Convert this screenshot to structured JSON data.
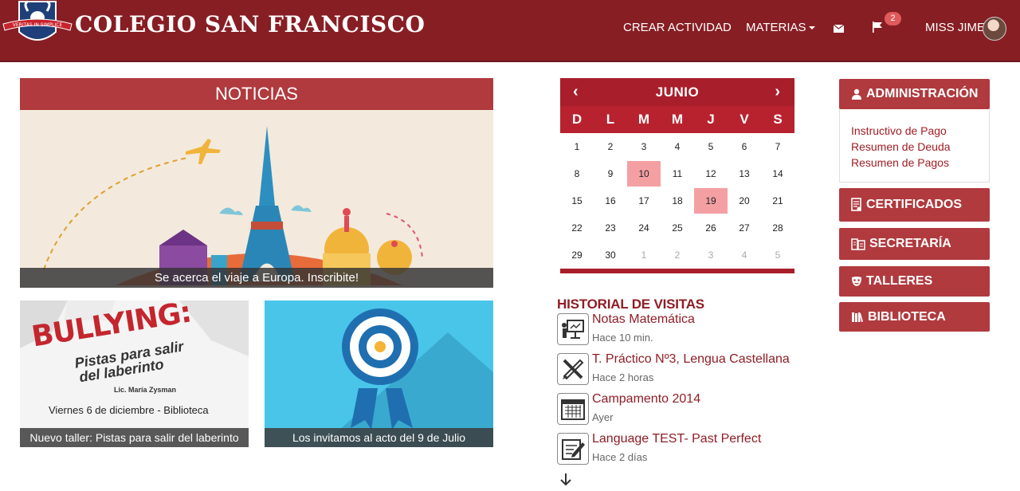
{
  "brand": {
    "title": "COLEGIO SAN FRANCISCO",
    "motto": "VERITAS IN SIMPLICE"
  },
  "nav": {
    "crear": "CREAR ACTIVIDAD",
    "materias": "MATERIAS",
    "notifications": "2",
    "user": "MISS JIME"
  },
  "news": {
    "header": "NOTICIAS",
    "hero_caption": "Se acerca el viaje a Europa. Inscribite!",
    "tile1_title_big": "BULLYING:",
    "tile1_title_1": "Pistas para salir",
    "tile1_title_2": "del laberinto",
    "tile1_author": "Lic. María Zysman",
    "tile1_date": "Viernes 6 de diciembre - Biblioteca",
    "tile1_caption": "Nuevo taller: Pistas para salir del laberinto",
    "tile2_caption": "Los invitamos al acto del 9 de Julio"
  },
  "calendar": {
    "prev": "‹",
    "next": "›",
    "month": "JUNIO",
    "weekdays": [
      "D",
      "L",
      "M",
      "M",
      "J",
      "V",
      "S"
    ],
    "days": [
      {
        "n": "1"
      },
      {
        "n": "2"
      },
      {
        "n": "3"
      },
      {
        "n": "4"
      },
      {
        "n": "5"
      },
      {
        "n": "6"
      },
      {
        "n": "7"
      },
      {
        "n": "8"
      },
      {
        "n": "9"
      },
      {
        "n": "10",
        "hl": true
      },
      {
        "n": "11"
      },
      {
        "n": "12"
      },
      {
        "n": "13"
      },
      {
        "n": "14"
      },
      {
        "n": "15"
      },
      {
        "n": "16"
      },
      {
        "n": "17"
      },
      {
        "n": "18"
      },
      {
        "n": "19",
        "hl": true
      },
      {
        "n": "20"
      },
      {
        "n": "21"
      },
      {
        "n": "22"
      },
      {
        "n": "23"
      },
      {
        "n": "24"
      },
      {
        "n": "25"
      },
      {
        "n": "26"
      },
      {
        "n": "27"
      },
      {
        "n": "28"
      },
      {
        "n": "29"
      },
      {
        "n": "30"
      },
      {
        "n": "1",
        "muted": true
      },
      {
        "n": "2",
        "muted": true
      },
      {
        "n": "3",
        "muted": true
      },
      {
        "n": "4",
        "muted": true
      },
      {
        "n": "5",
        "muted": true
      }
    ]
  },
  "history": {
    "title": "HISTORIAL DE VISITAS",
    "items": [
      {
        "name": "Notas Matemática",
        "time": "Hace 10 min.",
        "icon": "presentation-icon"
      },
      {
        "name": "T. Práctico Nº3, Lengua Castellana",
        "time": "Hace 2 horas",
        "icon": "pencil-ruler-icon"
      },
      {
        "name": "Campamento 2014",
        "time": "Ayer",
        "icon": "calendar-icon"
      },
      {
        "name": "Language TEST- Past Perfect",
        "time": "Hace 2 días",
        "icon": "edit-icon"
      }
    ]
  },
  "sidebar": {
    "admin": "ADMINISTRACIÓN",
    "admin_links": [
      "Instructivo de Pago",
      "Resumen de Deuda",
      "Resumen de Pagos"
    ],
    "certificados": "CERTIFICADOS",
    "secretaria": "SECRETARÍA",
    "talleres": "TALLERES",
    "biblioteca": "BIBLIOTECA"
  },
  "colors": {
    "navbar": "#871e24",
    "accent": "#b03a3e",
    "calendar": "#a91e2b",
    "highlight": "#f4a0a3",
    "link": "#8f1d24"
  }
}
